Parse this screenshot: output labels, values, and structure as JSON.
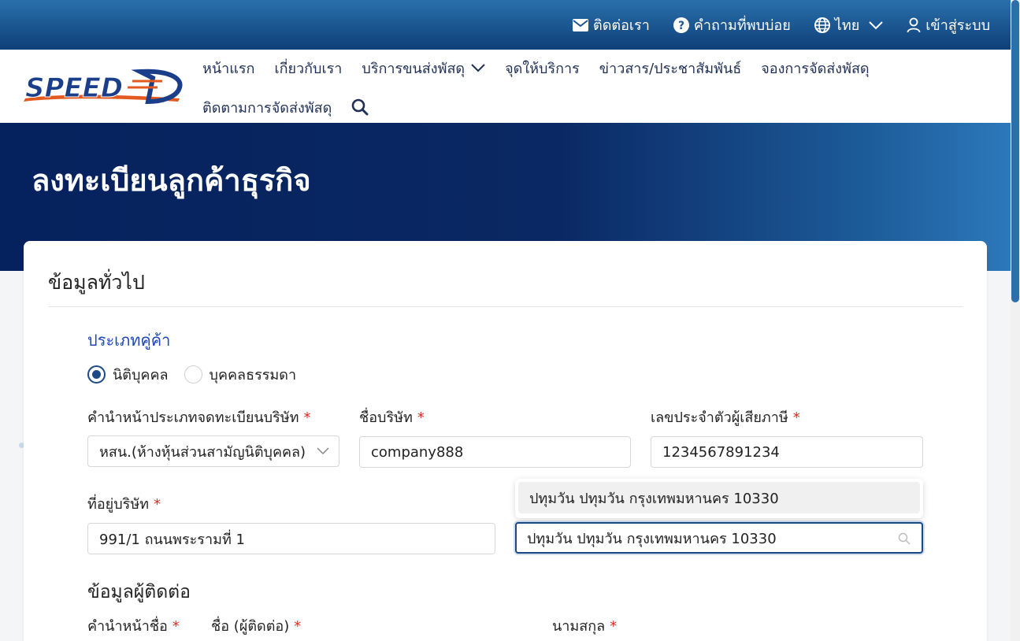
{
  "topbar": {
    "contact": "ติดต่อเรา",
    "faq": "คำถามที่พบบ่อย",
    "language": "ไทย",
    "login": "เข้าสู่ระบบ"
  },
  "brand": {
    "logo_text": "SPEED-D"
  },
  "nav": {
    "row1": [
      "หน้าแรก",
      "เกี่ยวกับเรา",
      "บริการขนส่งพัสดุ",
      "จุดให้บริการ",
      "ข่าวสาร/ประชาสัมพันธ์",
      "จองการจัดส่งพัสดุ"
    ],
    "row2": [
      "ติดตามการจัดส่งพัสดุ"
    ]
  },
  "hero": {
    "title": "ลงทะเบียนลูกค้าธุรกิจ"
  },
  "form": {
    "card_title": "ข้อมูลทั่วไป",
    "partner_type_label": "ประเภทคู่ค้า",
    "radio_juristic": "นิติบุคคล",
    "radio_individual": "บุคคลธรรมดา",
    "required_mark": "*",
    "prefix_label": "คำนำหน้าประเภทจดทะเบียนบริษัท",
    "prefix_value": "หสน.(ห้างหุ้นส่วนสามัญนิติบุคคล)",
    "company_label": "ชื่อบริษัท",
    "company_value": "company888",
    "taxid_label": "เลขประจำตัวผู้เสียภาษี",
    "taxid_value": "1234567891234",
    "address_label": "ที่อยู่บริษัท",
    "address_value": "991/1 ถนนพระรามที่ 1",
    "area_value": "ปทุมวัน ปทุมวัน กรุงเทพมหานคร 10330",
    "area_suggestion": "ปทุมวัน ปทุมวัน กรุงเทพมหานคร 10330",
    "contact_section": "ข้อมูลผู้ติดต่อ",
    "contact_prefix_label": "คำนำหน้าชื่อ",
    "contact_name_label": "ชื่อ (ผู้ติดต่อ)",
    "contact_surname_label": "นามสกุล"
  },
  "colors": {
    "primary": "#1b4a84",
    "header_dark": "#06225e",
    "required": "#e0281e",
    "section_blue": "#1f46b8"
  }
}
